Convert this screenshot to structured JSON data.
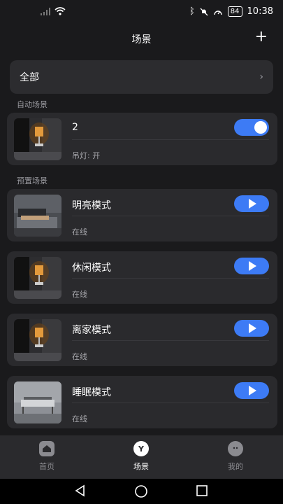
{
  "status_bar": {
    "time": "10:38",
    "battery": "84"
  },
  "header": {
    "title": "场景",
    "add_symbol": "+"
  },
  "filter": {
    "label": "全部",
    "chevron": "›"
  },
  "sections": {
    "auto": "自动场景",
    "preset": "预置场景"
  },
  "auto_scenes": [
    {
      "name": "2",
      "detail": "吊灯: 开",
      "enabled": true
    }
  ],
  "preset_scenes": [
    {
      "name": "明亮模式",
      "status": "在线"
    },
    {
      "name": "休闲模式",
      "status": "在线"
    },
    {
      "name": "离家模式",
      "status": "在线"
    },
    {
      "name": "睡眠模式",
      "status": "在线"
    }
  ],
  "tabs": [
    {
      "label": "首页",
      "icon": "home-icon",
      "active": false
    },
    {
      "label": "场景",
      "icon": "scene-icon",
      "active": true
    },
    {
      "label": "我的",
      "icon": "profile-icon",
      "active": false
    }
  ],
  "colors": {
    "accent": "#3d7bf5",
    "card": "#2a2a2d",
    "background": "#1a1a1c"
  }
}
